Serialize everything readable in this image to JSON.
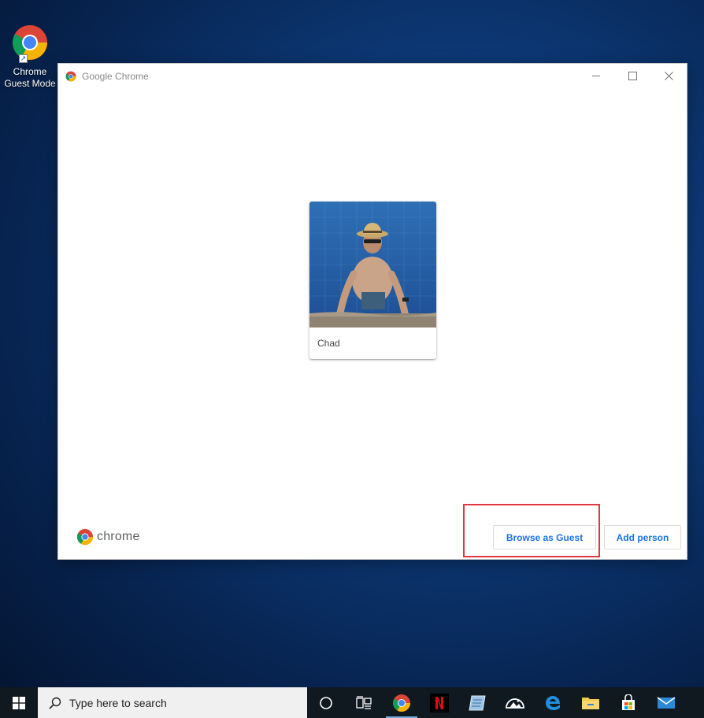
{
  "desktop": {
    "icon_label_line1": "Chrome",
    "icon_label_line2": "Guest Mode",
    "icon_name": "chrome-icon"
  },
  "window": {
    "title": "Google Chrome",
    "controls": [
      "minimize-icon",
      "maximize-icon",
      "close-icon"
    ]
  },
  "profile": {
    "name": "Chad"
  },
  "footer": {
    "logo_text": "chrome",
    "browse_guest_label": "Browse as Guest",
    "add_person_label": "Add person"
  },
  "taskbar": {
    "search_placeholder": "Type here to search",
    "apps": [
      "cortana-icon",
      "task-view-icon",
      "chrome-icon",
      "netflix-icon",
      "notepad-icon",
      "photos-icon",
      "edge-icon",
      "file-explorer-icon",
      "store-icon",
      "mail-icon"
    ]
  },
  "colors": {
    "accent": "#1a73e8",
    "highlight": "#e0383e",
    "taskbar": "#101820"
  }
}
